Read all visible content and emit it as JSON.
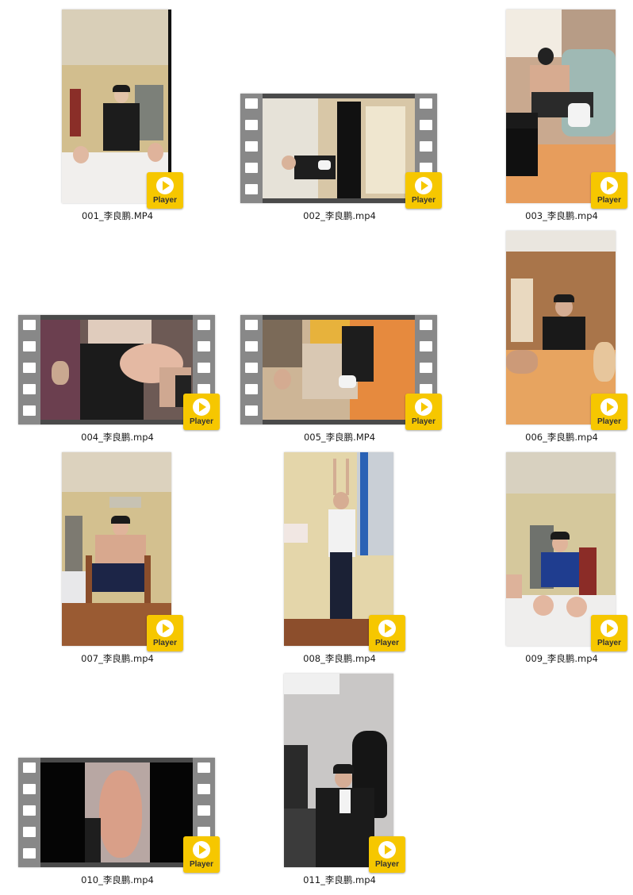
{
  "badge_label": "Player",
  "badge_icon": "play-circle-icon",
  "badge_color": "#f6c700",
  "files": [
    {
      "name": "001_李良鹏.MP4",
      "kind": "portrait"
    },
    {
      "name": "002_李良鹏.mp4",
      "kind": "filmstrip"
    },
    {
      "name": "003_李良鹏.mp4",
      "kind": "portrait"
    },
    {
      "name": "004_李良鹏.mp4",
      "kind": "filmstrip"
    },
    {
      "name": "005_李良鹏.MP4",
      "kind": "filmstrip"
    },
    {
      "name": "006_李良鹏.mp4",
      "kind": "portrait"
    },
    {
      "name": "007_李良鹏.mp4",
      "kind": "portrait"
    },
    {
      "name": "008_李良鹏.mp4",
      "kind": "portrait"
    },
    {
      "name": "009_李良鹏.mp4",
      "kind": "portrait"
    },
    {
      "name": "010_李良鹏.mp4",
      "kind": "filmstrip"
    },
    {
      "name": "011_李良鹏.mp4",
      "kind": "portrait"
    }
  ]
}
